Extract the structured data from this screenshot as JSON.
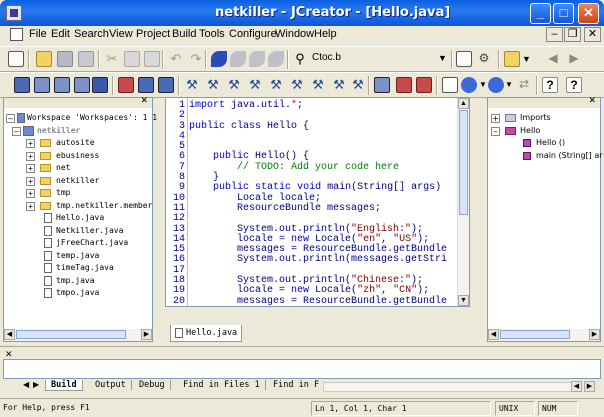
{
  "window": {
    "title": "netkiller - JCreator - [Hello.java]",
    "minimize": "_",
    "maximize": "□",
    "close": "✕"
  },
  "menu": [
    "File",
    "Edit",
    "Search",
    "View",
    "Project",
    "Build",
    "Tools",
    "Configure",
    "Window",
    "Help"
  ],
  "mdi": {
    "minimize": "–",
    "restore": "❐",
    "close": "✕"
  },
  "toolbar": {
    "combo_value": "Ctoc.b"
  },
  "workspace": {
    "root": "Workspace 'Workspaces': 1 1",
    "project": "netkiller",
    "folders": [
      "autosite",
      "ebusiness",
      "net",
      "netkiller",
      "tmp",
      "tmp.netkiller.member"
    ],
    "files": [
      "Hello.java",
      "Netkiller.java",
      "jFreeChart.java",
      "temp.java",
      "timeTag.java",
      "tmp.java",
      "tmpo.java"
    ]
  },
  "structure": {
    "imports": "Imports",
    "class": "Hello",
    "members": [
      "Hello ()",
      "main (String[] ar"
    ]
  },
  "editor": {
    "tab": "Hello.java",
    "lines": [
      {
        "n": "1",
        "text": "import java.util.*;"
      },
      {
        "n": "2",
        "text": ""
      },
      {
        "n": "3",
        "text": "public class Hello {"
      },
      {
        "n": "4",
        "text": ""
      },
      {
        "n": "5",
        "text": ""
      },
      {
        "n": "6",
        "text": "    public Hello() {"
      },
      {
        "n": "7",
        "text": "        // TODO: Add your code here"
      },
      {
        "n": "8",
        "text": "    }"
      },
      {
        "n": "9",
        "text": "    public static void main(String[] args)"
      },
      {
        "n": "10",
        "text": "        Locale locale;"
      },
      {
        "n": "11",
        "text": "        ResourceBundle messages;"
      },
      {
        "n": "12",
        "text": ""
      },
      {
        "n": "13",
        "text": "        System.out.println(\"English:\");"
      },
      {
        "n": "14",
        "text": "        locale = new Locale(\"en\", \"US\");"
      },
      {
        "n": "15",
        "text": "        messages = ResourceBundle.getBundle"
      },
      {
        "n": "16",
        "text": "        System.out.println(messages.getStri"
      },
      {
        "n": "17",
        "text": ""
      },
      {
        "n": "18",
        "text": "        System.out.println(\"Chinese:\");"
      },
      {
        "n": "19",
        "text": "        locale = new Locale(\"zh\", \"CN\");"
      },
      {
        "n": "20",
        "text": "        messages = ResourceBundle.getBundle"
      }
    ]
  },
  "output_tabs": [
    "Build",
    "Output",
    "Debug",
    "Find in Files 1",
    "Find in F"
  ],
  "status": {
    "help": "For Help, press F1",
    "position": "Ln 1, Col 1, Char 1",
    "mode": "UNIX",
    "num": "NUM"
  }
}
